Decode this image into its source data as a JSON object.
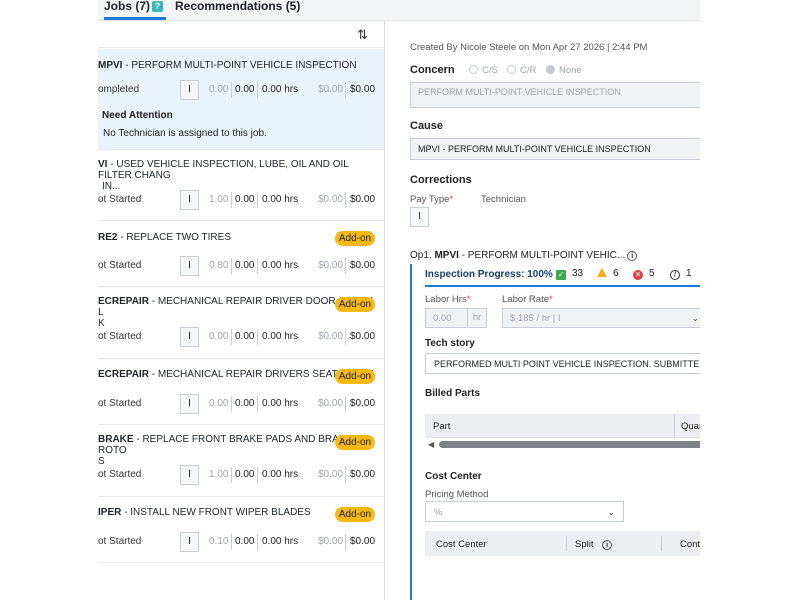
{
  "tabs": {
    "jobs_label": "Jobs (7)",
    "jobs_badge": "?",
    "recommendations_label": "Recommendations (5)"
  },
  "jobs": [
    {
      "code": "MPVI",
      "desc": "PERFORM MULTI-POINT VEHICLE INSPECTION",
      "status": "ompleted",
      "pay": "I",
      "hrs_muted": "0.00",
      "hrs_bill": "0.00",
      "hrs_total": "0.00 hrs",
      "amt_muted": "$0.00",
      "amt": "$0.00",
      "need_attention": "Need Attention",
      "no_tech": "No Technician is assigned to this job."
    },
    {
      "code": "VI",
      "desc": "USED VEHICLE INSPECTION, LUBE, OIL AND OIL FILTER CHANG",
      "desc2": "IN...",
      "status": "ot Started",
      "pay": "I",
      "hrs_muted": "1.00",
      "hrs_bill": "0.00",
      "hrs_total": "0.00 hrs",
      "amt_muted": "$0.00",
      "amt": "$0.00"
    },
    {
      "code": "RE2",
      "desc": "REPLACE TWO TIRES",
      "status": "ot Started",
      "pay": "I",
      "hrs_muted": "0.80",
      "hrs_bill": "0.00",
      "hrs_total": "0.00 hrs",
      "amt_muted": "$0.00",
      "amt": "$0.00",
      "addon": "Add-on"
    },
    {
      "code": "ECREPAIR",
      "desc": "MECHANICAL REPAIR DRIVER DOOR CHECK L",
      "desc2": "K",
      "status": "ot Started",
      "pay": "I",
      "hrs_muted": "0.00",
      "hrs_bill": "0.00",
      "hrs_total": "0.00 hrs",
      "amt_muted": "$0.00",
      "amt": "$0.00",
      "addon": "Add-on"
    },
    {
      "code": "ECREPAIR",
      "desc": "MECHANICAL REPAIR DRIVERS SEAT TRACK",
      "status": "ot Started",
      "pay": "I",
      "hrs_muted": "0.00",
      "hrs_bill": "0.00",
      "hrs_total": "0.00 hrs",
      "amt_muted": "$0.00",
      "amt": "$0.00",
      "addon": "Add-on"
    },
    {
      "code": "BRAKE",
      "desc": "REPLACE FRONT BRAKE PADS AND BRAKE ROTO",
      "desc2": "S",
      "status": "ot Started",
      "pay": "I",
      "hrs_muted": "1.00",
      "hrs_bill": "0.00",
      "hrs_total": "0.00 hrs",
      "amt_muted": "$0.00",
      "amt": "$0.00",
      "addon": "Add-on"
    },
    {
      "code": "IPER",
      "desc": "INSTALL NEW FRONT WIPER BLADES",
      "status": "ot Started",
      "pay": "I",
      "hrs_muted": "0.10",
      "hrs_bill": "0.00",
      "hrs_total": "0.00 hrs",
      "amt_muted": "$0.00",
      "amt": "$0.00",
      "addon": "Add-on"
    }
  ],
  "detail": {
    "created": "Created By Nicole Steele on Mon Apr 27 2026 | 2:44 PM",
    "concern_label": "Concern",
    "radio_cs": "C/S",
    "radio_cr": "C/R",
    "radio_none": "None",
    "concern_value": "PERFORM MULTI-POINT VEHICLE INSPECTION",
    "cause_label": "Cause",
    "cause_value": "MPVI - PERFORM MULTI-POINT VEHICLE INSPECTION",
    "corrections_label": "Corrections",
    "pay_type_label": "Pay Type",
    "pay_type_value": "I",
    "technician_label": "Technician",
    "op_prefix": "Op1.",
    "op_code": "MPVI",
    "op_desc": "- PERFORM MULTI-POINT VEHIC...",
    "progress_label": "Inspection Progress: 100%",
    "count_ok": "33",
    "count_warn": "6",
    "count_fail": "5",
    "count_na": "1",
    "labor_hrs_label": "Labor Hrs",
    "labor_hrs_value": "0.00",
    "labor_hrs_unit": "hr",
    "labor_rate_label": "Labor Rate",
    "labor_rate_value": "$ 185 / hr | I",
    "tech_story_label": "Tech story",
    "tech_story_value": "PERFORMED MULTI POINT VEHICLE INSPECTION. SUBMITTED INS",
    "billed_parts_label": "Billed Parts",
    "parts_col_part": "Part",
    "parts_col_qty": "Quan",
    "cost_center_label": "Cost Center",
    "pricing_method_label": "Pricing Method",
    "pricing_method_value": "%",
    "cc_col_center": "Cost Center",
    "cc_col_split": "Split",
    "cc_col_contr": "Contr"
  },
  "colors": {
    "accent": "#1b7bd6",
    "addon": "#f5b916",
    "selected_row": "#eaf3fc",
    "ok": "#3ea84b",
    "warn": "#f2b01e",
    "fail": "#e23c3c"
  }
}
